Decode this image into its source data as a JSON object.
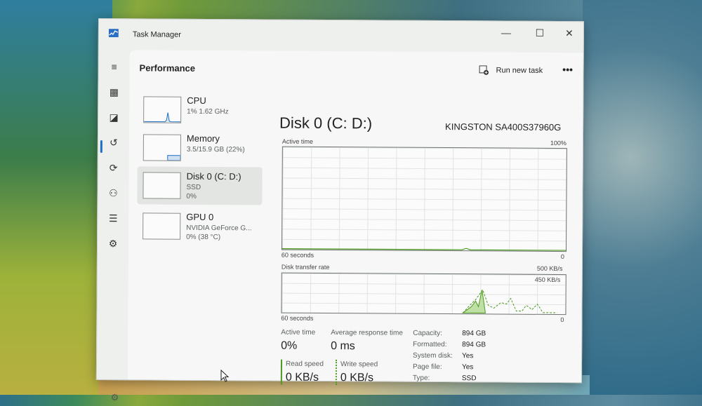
{
  "window": {
    "title": "Task Manager",
    "minimize": "—",
    "maximize": "☐",
    "close": "✕"
  },
  "nav": [
    {
      "icon": "hamburger-icon",
      "glyph": "≡"
    },
    {
      "icon": "processes-icon",
      "glyph": "▦"
    },
    {
      "icon": "performance-icon",
      "glyph": "◪"
    },
    {
      "icon": "app-history-icon",
      "glyph": "↺"
    },
    {
      "icon": "startup-apps-icon",
      "glyph": "⟳"
    },
    {
      "icon": "users-icon",
      "glyph": "⚇"
    },
    {
      "icon": "details-icon",
      "glyph": "☰"
    },
    {
      "icon": "services-icon",
      "glyph": "⚙"
    }
  ],
  "settings_icon": {
    "icon": "settings-icon",
    "glyph": "⚙"
  },
  "header": {
    "title": "Performance",
    "run_new_task": "Run new task",
    "more": "•••"
  },
  "resources": [
    {
      "name": "CPU",
      "sub1": "1% 1.62 GHz",
      "sub2": "",
      "selected": false
    },
    {
      "name": "Memory",
      "sub1": "3.5/15.9 GB (22%)",
      "sub2": "",
      "selected": false
    },
    {
      "name": "Disk 0 (C: D:)",
      "sub1": "SSD",
      "sub2": "0%",
      "selected": true
    },
    {
      "name": "GPU 0",
      "sub1": "NVIDIA GeForce G...",
      "sub2": "0% (38 °C)",
      "selected": false
    }
  ],
  "detail": {
    "title": "Disk 0 (C: D:)",
    "model": "KINGSTON SA400S37960G",
    "active_time_graph": {
      "label": "Active time",
      "max": "100%",
      "x_label": "60 seconds",
      "min": "0"
    },
    "transfer_graph": {
      "label": "Disk transfer rate",
      "max": "500 KB/s",
      "inner_max": "450 KB/s",
      "x_label": "60 seconds",
      "min": "0"
    },
    "stats": {
      "active_time_label": "Active time",
      "active_time_value": "0%",
      "avg_response_label": "Average response time",
      "avg_response_value": "0 ms",
      "read_label": "Read speed",
      "read_value": "0 KB/s",
      "write_label": "Write speed",
      "write_value": "0 KB/s"
    },
    "properties": [
      {
        "label": "Capacity:",
        "value": "894 GB"
      },
      {
        "label": "Formatted:",
        "value": "894 GB"
      },
      {
        "label": "System disk:",
        "value": "Yes"
      },
      {
        "label": "Page file:",
        "value": "Yes"
      },
      {
        "label": "Type:",
        "value": "SSD"
      }
    ]
  },
  "colors": {
    "disk_line": "#4d9a1f",
    "disk_fill": "#bfe0a4",
    "accent": "#1f6fc4"
  }
}
